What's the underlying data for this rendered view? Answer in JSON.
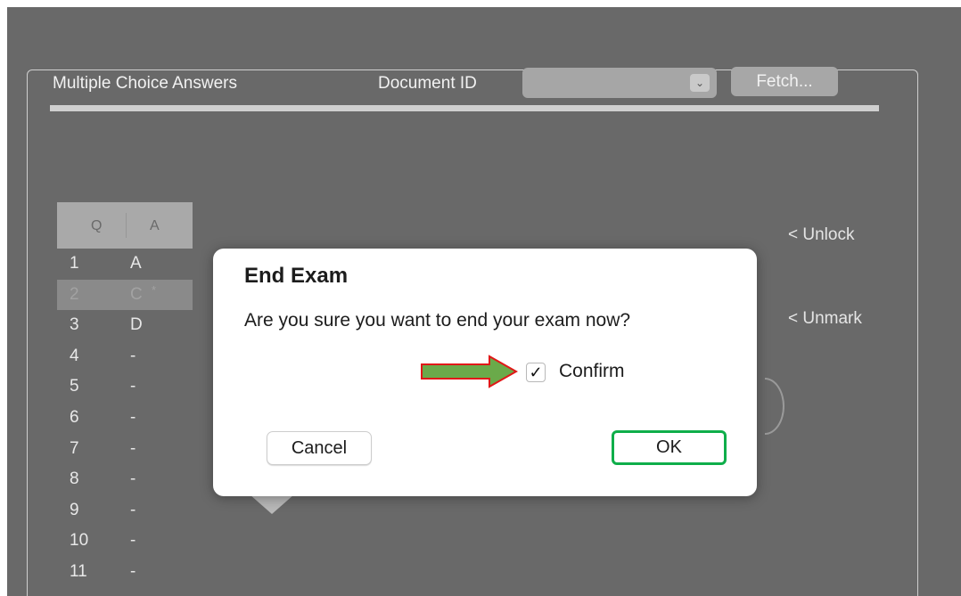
{
  "header": {
    "title": "Multiple Choice Answers",
    "doc_id_label": "Document ID",
    "doc_id_value": "",
    "chevron_icon": "chevron-down-icon",
    "fetch_label": "Fetch..."
  },
  "answers_table": {
    "col_q": "Q",
    "col_a": "A",
    "rows": [
      {
        "q": "1",
        "a": "A",
        "mark": ""
      },
      {
        "q": "2",
        "a": "C",
        "mark": "*"
      },
      {
        "q": "3",
        "a": "D",
        "mark": ""
      },
      {
        "q": "4",
        "a": "-",
        "mark": ""
      },
      {
        "q": "5",
        "a": "-",
        "mark": ""
      },
      {
        "q": "6",
        "a": "-",
        "mark": ""
      },
      {
        "q": "7",
        "a": "-",
        "mark": ""
      },
      {
        "q": "8",
        "a": "-",
        "mark": ""
      },
      {
        "q": "9",
        "a": "-",
        "mark": ""
      },
      {
        "q": "10",
        "a": "-",
        "mark": ""
      },
      {
        "q": "11",
        "a": "-",
        "mark": ""
      }
    ],
    "selected_row": 1
  },
  "side_actions": {
    "unlock_label": "< Unlock",
    "unmark_label": "< Unmark"
  },
  "dialog": {
    "title": "End Exam",
    "message": "Are you sure you want to end your exam now?",
    "confirm_label": "Confirm",
    "confirm_checked": true,
    "checkmark": "✓",
    "cancel_label": "Cancel",
    "ok_label": "OK"
  },
  "annotations": {
    "arrow_fill": "#6aaa4a",
    "arrow_stroke": "#e01818",
    "ok_highlight": "#0fae4a"
  }
}
